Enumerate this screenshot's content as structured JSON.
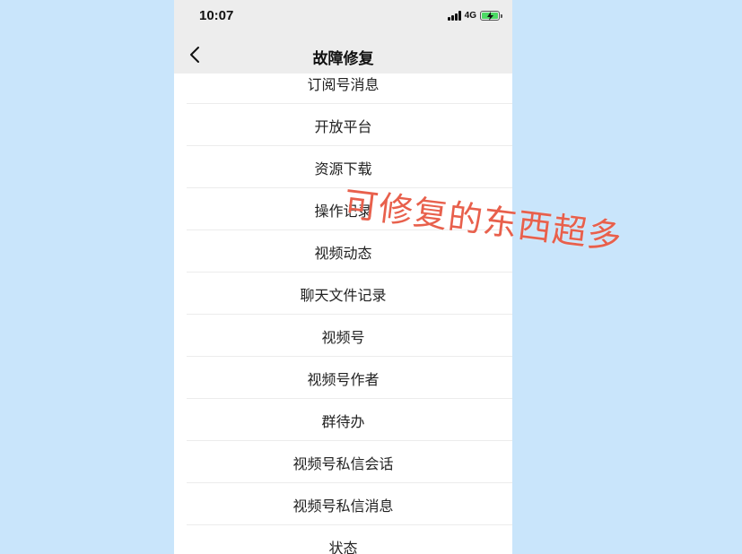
{
  "status_bar": {
    "time": "10:07",
    "network": "4G",
    "signal_icon": "signal-bars-icon",
    "battery_icon": "battery-charging-icon"
  },
  "nav": {
    "back_icon": "chevron-left-icon",
    "title": "故障修复"
  },
  "list": {
    "items": [
      "订阅号消息",
      "开放平台",
      "资源下载",
      "操作记录",
      "视频动态",
      "聊天文件记录",
      "视频号",
      "视频号作者",
      "群待办",
      "视频号私信会话",
      "视频号私信消息",
      "状态"
    ]
  },
  "overlay": {
    "caption": "可修复的东西超多"
  },
  "colors": {
    "background": "#c9e5fb",
    "bar_bg": "#ededed",
    "caption": "#e8604c",
    "battery": "#4cd964"
  }
}
